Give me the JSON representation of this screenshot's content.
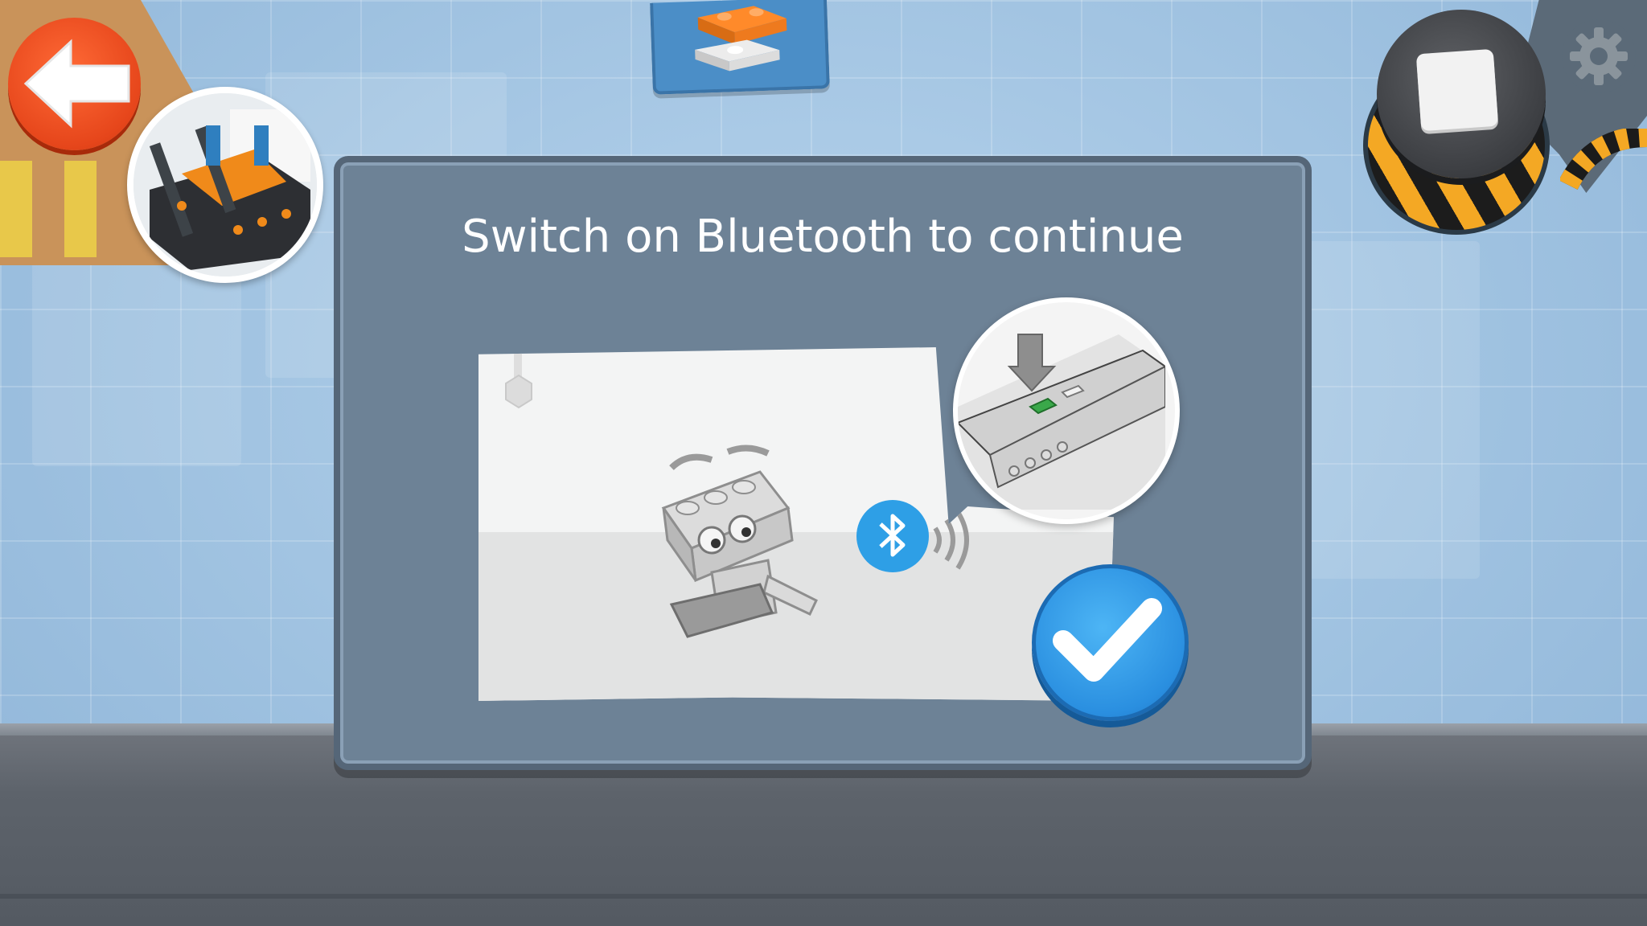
{
  "dialog": {
    "title": "Switch on Bluetooth to continue"
  },
  "icons": {
    "back": "back-arrow-icon",
    "model": "model-thumbnail",
    "bricks": "brick-palette-icon",
    "stop": "stop-icon",
    "settings": "gear-icon",
    "bluetooth": "bluetooth-icon",
    "confirm": "checkmark-icon"
  },
  "colors": {
    "dialog_bg": "#6d8296",
    "confirm": "#2a8fe0",
    "back": "#e6461b",
    "bluetooth": "#2e9fe6"
  }
}
